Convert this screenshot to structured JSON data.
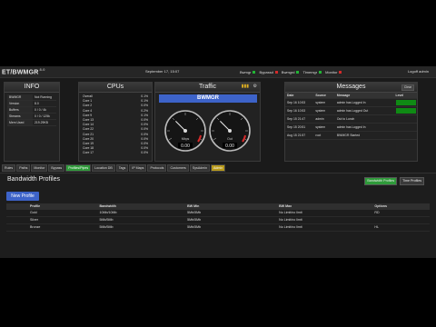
{
  "app": {
    "title": "ET/BWMGR",
    "version": "8.0",
    "date": "September 17, 15:07",
    "logout": "Logoff admin"
  },
  "flags": [
    {
      "label": "Bwmgr",
      "color": "#21b534"
    },
    {
      "label": "Bypassd",
      "color": "#d42a2a"
    },
    {
      "label": "Bwmgrd",
      "color": "#21b534"
    },
    {
      "label": "Timemgr",
      "color": "#21b534"
    },
    {
      "label": "Monitor",
      "color": "#d42a2a"
    }
  ],
  "info": {
    "title": "INFO",
    "rows": [
      {
        "key": "BWMGR",
        "value": "Not Running"
      },
      {
        "key": "Version",
        "value": "8.0"
      },
      {
        "key": "Buffers",
        "value": "0 / 0 / 4k"
      },
      {
        "key": "Streams",
        "value": "0 / 0 / 125k"
      },
      {
        "key": "Mem Used",
        "value": "219.29KB"
      }
    ]
  },
  "cpus": {
    "title": "CPUs",
    "rows": [
      {
        "core": "Overall",
        "load": "0.1%"
      },
      {
        "core": "Core 1",
        "load": "0.1%"
      },
      {
        "core": "Core 2",
        "load": "0.0%"
      },
      {
        "core": "Core 4",
        "load": "0.2%"
      },
      {
        "core": "Core 9",
        "load": "0.1%"
      },
      {
        "core": "Core 13",
        "load": "0.0%"
      },
      {
        "core": "Core 14",
        "load": "0.0%"
      },
      {
        "core": "Core 22",
        "load": "0.0%"
      },
      {
        "core": "Core 21",
        "load": "0.0%"
      },
      {
        "core": "Core 20",
        "load": "0.0%"
      },
      {
        "core": "Core 19",
        "load": "0.0%"
      },
      {
        "core": "Core 18",
        "load": "0.0%"
      },
      {
        "core": "Core 17",
        "load": "0.0%"
      }
    ]
  },
  "traffic": {
    "title": "Traffic",
    "bar_label": "BWMGR",
    "gauges": [
      {
        "label": "Mbps",
        "value": "0.00",
        "level": 0.0
      },
      {
        "label": "Out",
        "value": "0.00",
        "level": 0.0
      }
    ]
  },
  "messages": {
    "title": "Messages",
    "clear_label": "Clear",
    "columns": [
      "Date",
      "Source",
      "Message",
      "Level"
    ],
    "rows": [
      {
        "date": "Sep 16 10:53",
        "source": "system",
        "message": "admin has Logged In",
        "level_color": "#0f8a14"
      },
      {
        "date": "Sep 16 10:53",
        "source": "system",
        "message": "admin has Logged Out",
        "level_color": "#0f8a14"
      },
      {
        "date": "Sep 15 21:47",
        "source": "admin",
        "message": "Out to Lunch",
        "level_color": ""
      },
      {
        "date": "Sep 15 20:51",
        "source": "system",
        "message": "admin has Logged In",
        "level_color": ""
      },
      {
        "date": "Aug 15 21:57",
        "source": "root",
        "message": "BWMGR Started",
        "level_color": ""
      }
    ]
  },
  "tabs": [
    {
      "label": "Rules",
      "state": ""
    },
    {
      "label": "Paths",
      "state": ""
    },
    {
      "label": "Monitor",
      "state": ""
    },
    {
      "label": "Bypass",
      "state": ""
    },
    {
      "label": "Profiles/Pipes",
      "state": "active"
    },
    {
      "label": "Location DB",
      "state": ""
    },
    {
      "label": "Tags",
      "state": ""
    },
    {
      "label": "IP Maps",
      "state": ""
    },
    {
      "label": "Protocols",
      "state": ""
    },
    {
      "label": "Customers",
      "state": ""
    },
    {
      "label": "SysAdmin",
      "state": ""
    },
    {
      "label": "Admin",
      "state": "admin"
    }
  ],
  "section": {
    "title": "Bandwidth Profiles",
    "btn_bandwidth": "Bandwidth Profiles",
    "btn_time": "Time Profiles",
    "new_button": "New Profile",
    "columns": [
      "Profile",
      "Bandwidth",
      "BW Min",
      "BW Max",
      "Options"
    ],
    "rows": [
      {
        "profile": "Gold",
        "bandwidth": "10Mb/10Mb",
        "bw_min": "5Mb/5Mb",
        "bw_max": "No Limit/no limit",
        "options": "RD"
      },
      {
        "profile": "Silver",
        "bandwidth": "5Mb/5Mb",
        "bw_min": "5Mb/5Mb",
        "bw_max": "No Limit/no limit",
        "options": ""
      },
      {
        "profile": "Bronze",
        "bandwidth": "5Mb/5Mb",
        "bw_min": "5Mb/5Mb",
        "bw_max": "No Limit/no limit",
        "options": "HL"
      }
    ]
  }
}
